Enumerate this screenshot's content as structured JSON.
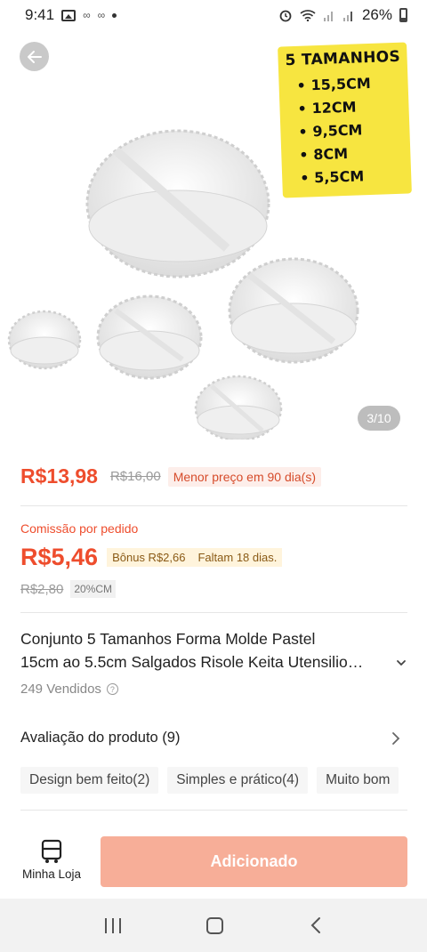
{
  "status_bar": {
    "time": "9:41",
    "battery": "26%"
  },
  "hero": {
    "size_card": {
      "title": "5 TAMANHOS",
      "sizes": [
        "15,5CM",
        "12CM",
        "9,5CM",
        "8CM",
        "5,5CM"
      ]
    },
    "pager": "3/10"
  },
  "price": {
    "current": "R$13,98",
    "original": "R$16,00",
    "tag": "Menor preço em 90 dia(s)"
  },
  "commission": {
    "label": "Comissão por pedido",
    "value": "R$5,46",
    "bonus": "Bônus R$2,66",
    "remaining": "Faltam 18 dias.",
    "old_value": "R$2,80",
    "rate": "20%CM"
  },
  "product": {
    "title_line1": "Conjunto 5 Tamanhos Forma Molde Pastel",
    "title_line2": "15cm ao 5.5cm Salgados Risole Keita Utensilio…",
    "sold": "249 Vendidos"
  },
  "reviews": {
    "heading": "Avaliação do produto (9)",
    "chips": [
      "Design bem feito(2)",
      "Simples e prático(4)",
      "Muito bom"
    ]
  },
  "actions": {
    "shop_label": "Minha Loja",
    "add_label": "Adicionado"
  },
  "colors": {
    "accent": "#ee4d2d",
    "button_disabled": "#f7ae98",
    "size_card": "#f7e540"
  }
}
